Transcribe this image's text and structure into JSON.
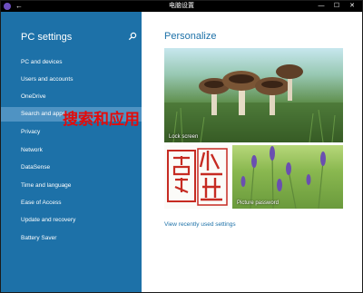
{
  "window": {
    "title": "电脑设置",
    "back_glyph": "←",
    "min_glyph": "—",
    "max_glyph": "☐",
    "close_glyph": "✕"
  },
  "sidebar": {
    "title": "PC settings",
    "items": [
      {
        "label": "PC and devices"
      },
      {
        "label": "Users and accounts"
      },
      {
        "label": "OneDrive"
      },
      {
        "label": "Search and apps",
        "selected": true
      },
      {
        "label": "Privacy"
      },
      {
        "label": "Network"
      },
      {
        "label": "DataSense"
      },
      {
        "label": "Time and language"
      },
      {
        "label": "Ease of Access"
      },
      {
        "label": "Update and recovery"
      },
      {
        "label": "Battery Saver"
      }
    ]
  },
  "annotation": "搜索和应用",
  "main": {
    "title": "Personalize",
    "lock_screen_label": "Lock screen",
    "picture_password_label": "Picture password",
    "recent_link": "View recently used settings"
  },
  "colors": {
    "accent": "#1d71a8",
    "selected": "#4f93c3",
    "annotation": "#e30b0b",
    "seal": "#c62b22"
  }
}
